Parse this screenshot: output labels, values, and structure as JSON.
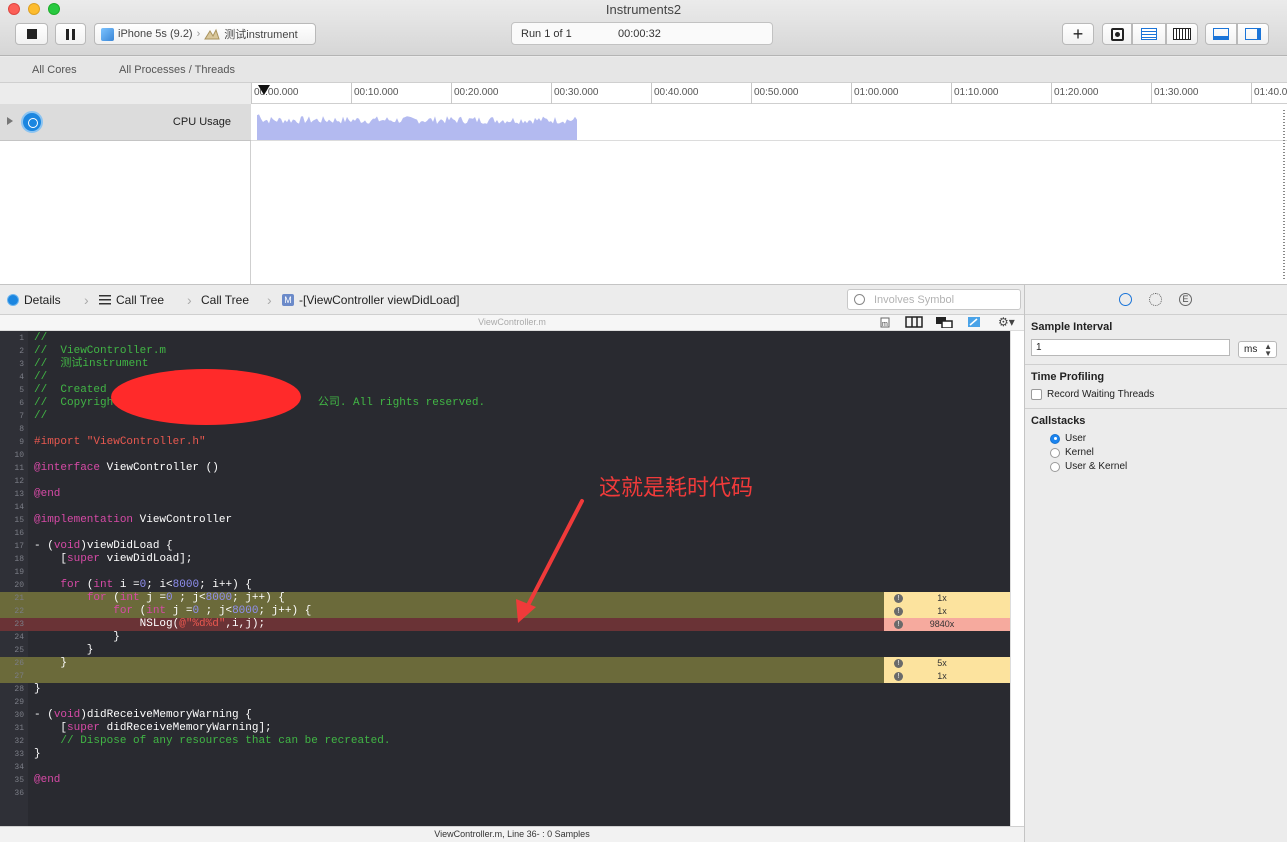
{
  "window": {
    "title": "Instruments2",
    "target_device": "iPhone 5s (9.2)",
    "target_app": "测试instrument",
    "run_label": "Run 1 of 1",
    "elapsed": "00:00:32"
  },
  "scope": {
    "cores": "All Cores",
    "processes": "All Processes / Threads"
  },
  "ruler_ticks": [
    "00:00.000",
    "00:10.000",
    "00:20.000",
    "00:30.000",
    "00:40.000",
    "00:50.000",
    "01:00.000",
    "01:10.000",
    "01:20.000",
    "01:30.000",
    "01:40.0"
  ],
  "track": {
    "name": "CPU Usage",
    "color": "#b3baf0"
  },
  "jumpbar": {
    "details": "Details",
    "call_tree_1": "Call Tree",
    "call_tree_2": "Call Tree",
    "symbol": "-[ViewController viewDidLoad]",
    "search_placeholder": "Involves Symbol"
  },
  "source": {
    "file_name": "ViewController.m",
    "status": "ViewController.m, Line 36- : 0 Samples",
    "lines": [
      {
        "n": "1",
        "html": "<span class='c-comment'>//</span>"
      },
      {
        "n": "2",
        "html": "<span class='c-comment'>//  ViewController.m</span>"
      },
      {
        "n": "3",
        "html": "<span class='c-comment'>//  测试instrument</span>"
      },
      {
        "n": "4",
        "html": "<span class='c-comment'>//</span>"
      },
      {
        "n": "5",
        "html": "<span class='c-comment'>//  Created</span>"
      },
      {
        "n": "6",
        "html": "<span class='c-comment'>//  Copyright                              公司. All rights reserved.</span>"
      },
      {
        "n": "7",
        "html": "<span class='c-comment'>//</span>"
      },
      {
        "n": "8",
        "html": ""
      },
      {
        "n": "9",
        "html": "<span class='c-str'>#import \"ViewController.h\"</span>"
      },
      {
        "n": "10",
        "html": ""
      },
      {
        "n": "11",
        "html": "<span class='c-kw'>@interface</span> ViewController ()"
      },
      {
        "n": "12",
        "html": ""
      },
      {
        "n": "13",
        "html": "<span class='c-kw'>@end</span>"
      },
      {
        "n": "14",
        "html": ""
      },
      {
        "n": "15",
        "html": "<span class='c-kw'>@implementation</span> ViewController"
      },
      {
        "n": "16",
        "html": ""
      },
      {
        "n": "17",
        "html": "- (<span class='c-kw'>void</span>)viewDidLoad {"
      },
      {
        "n": "18",
        "html": "    [<span class='c-kw'>super</span> viewDidLoad];"
      },
      {
        "n": "19",
        "html": ""
      },
      {
        "n": "20",
        "html": "    <span class='c-kw'>for</span> (<span class='c-kw'>int</span> i =<span class='c-num'>0</span>; i&lt;<span class='c-num'>8000</span>; i++) {"
      },
      {
        "n": "21",
        "html": "        <span class='c-kw'>for</span> (<span class='c-kw'>int</span> j =<span class='c-num'>0</span> ; j&lt;<span class='c-num'>8000</span>; j++) {",
        "hl": "y",
        "badge": {
          "kind": "y",
          "count": "1x"
        }
      },
      {
        "n": "22",
        "html": "            <span class='c-kw'>for</span> (<span class='c-kw'>int</span> j =<span class='c-num'>0</span> ; j&lt;<span class='c-num'>8000</span>; j++) {",
        "hl": "y",
        "badge": {
          "kind": "y",
          "count": "1x"
        }
      },
      {
        "n": "23",
        "html": "                NSLog(<span class='c-str'>@\"%d%d\"</span>,i,j);",
        "hl": "r",
        "badge": {
          "kind": "r",
          "count": "9840x"
        }
      },
      {
        "n": "24",
        "html": "            }"
      },
      {
        "n": "25",
        "html": "        }"
      },
      {
        "n": "26",
        "html": "    }",
        "hl": "y",
        "badge": {
          "kind": "y",
          "count": "5x"
        }
      },
      {
        "n": "27",
        "html": "",
        "hl": "y",
        "badge": {
          "kind": "y",
          "count": "1x"
        }
      },
      {
        "n": "28",
        "html": "}"
      },
      {
        "n": "29",
        "html": ""
      },
      {
        "n": "30",
        "html": "- (<span class='c-kw'>void</span>)didReceiveMemoryWarning {"
      },
      {
        "n": "31",
        "html": "    [<span class='c-kw'>super</span> didReceiveMemoryWarning];"
      },
      {
        "n": "32",
        "html": "    <span class='c-comment'>// Dispose of any resources that can be recreated.</span>"
      },
      {
        "n": "33",
        "html": "}"
      },
      {
        "n": "34",
        "html": ""
      },
      {
        "n": "35",
        "html": "<span class='c-kw'>@end</span>"
      },
      {
        "n": "36",
        "html": ""
      }
    ]
  },
  "inspector": {
    "sample_interval_title": "Sample Interval",
    "sample_interval_value": "1",
    "sample_interval_unit": "ms",
    "time_profiling_title": "Time Profiling",
    "record_waiting": "Record Waiting Threads",
    "callstacks_title": "Callstacks",
    "callstack_options": [
      {
        "label": "User",
        "selected": true
      },
      {
        "label": "Kernel",
        "selected": false
      },
      {
        "label": "User & Kernel",
        "selected": false
      }
    ]
  },
  "annotation": {
    "text": "这就是耗时代码",
    "color": "#f03a3a"
  }
}
